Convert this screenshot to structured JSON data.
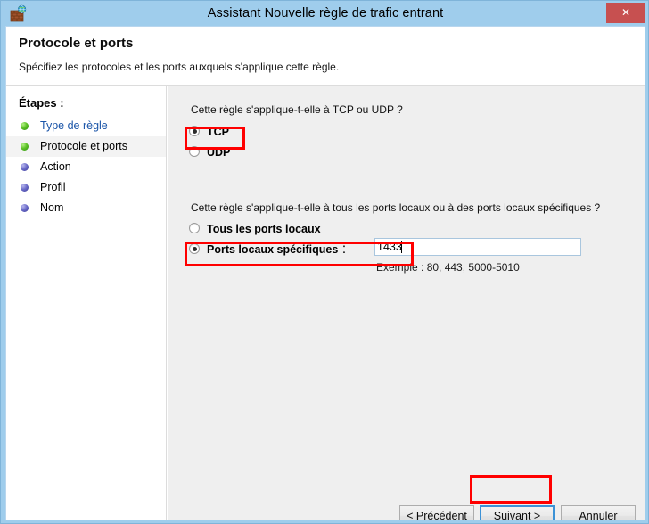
{
  "window": {
    "title": "Assistant Nouvelle règle de trafic entrant",
    "icon": "firewall-brick-wall-globe-icon",
    "close_label": "✕",
    "titlebar_color": "#9fcdec",
    "close_button_color": "#c75050"
  },
  "header": {
    "title": "Protocole et ports",
    "subtitle": "Spécifiez les protocoles et les ports auxquels s'applique cette règle."
  },
  "sidebar": {
    "heading": "Étapes :",
    "items": [
      {
        "label": "Type de règle",
        "bullet": "green",
        "state": "completed-link"
      },
      {
        "label": "Protocole et ports",
        "bullet": "green",
        "state": "current"
      },
      {
        "label": "Action",
        "bullet": "blue",
        "state": "pending"
      },
      {
        "label": "Profil",
        "bullet": "blue",
        "state": "pending"
      },
      {
        "label": "Nom",
        "bullet": "blue",
        "state": "pending"
      }
    ]
  },
  "main": {
    "protocol_question": "Cette règle s'applique-t-elle à TCP ou UDP ?",
    "protocol_options": [
      {
        "label": "TCP",
        "checked": true
      },
      {
        "label": "UDP",
        "checked": false
      }
    ],
    "ports_question": "Cette règle s'applique-t-elle à tous les ports locaux ou à des ports locaux spécifiques ?",
    "ports_options": [
      {
        "label": "Tous les ports locaux",
        "suffix": "",
        "checked": false
      },
      {
        "label": "Ports locaux spécifiques",
        "suffix": " :",
        "checked": true
      }
    ],
    "ports_input_value": "1433",
    "ports_example": "Exemple : 80, 443, 5000-5010"
  },
  "footer": {
    "previous_accel": "<",
    "previous_rest": " Précédent",
    "next_pre": "Sui",
    "next_accel": "v",
    "next_rest": "ant >",
    "cancel_label": "Annuler"
  },
  "annotations": {
    "color": "#ff0000",
    "boxes": [
      "tcp-radio",
      "ports-locaux-specifiques-radio",
      "suivant-button"
    ]
  }
}
